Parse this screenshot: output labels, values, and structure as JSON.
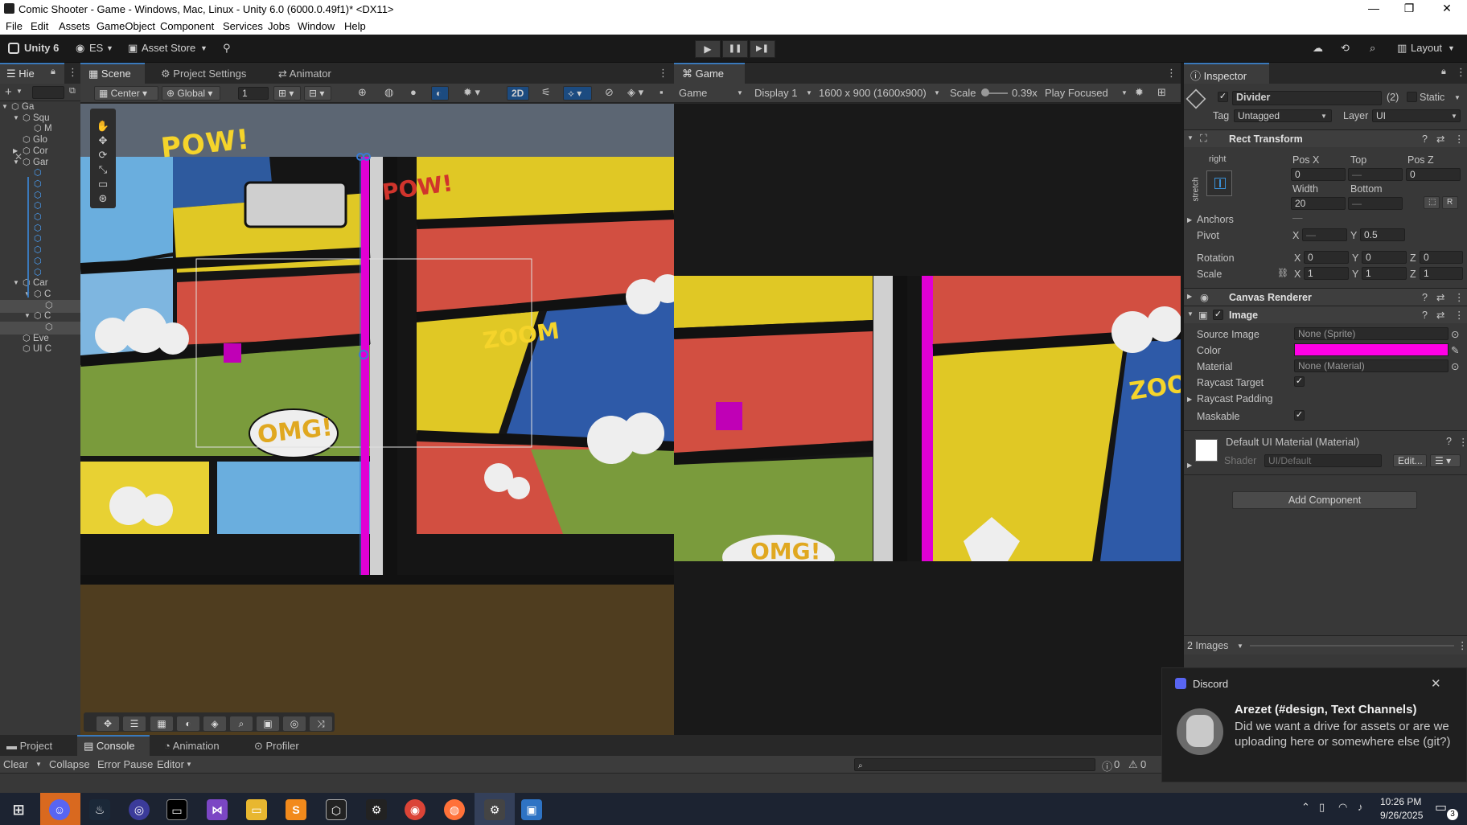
{
  "window": {
    "title": "Comic Shooter - Game - Windows, Mac, Linux - Unity 6.0 (6000.0.49f1)* <DX11>",
    "min": "—",
    "max": "❐",
    "close": "✕"
  },
  "menu": [
    "File",
    "Edit",
    "Assets",
    "GameObject",
    "Component",
    "Services",
    "Jobs",
    "Window",
    "Help"
  ],
  "toolbar": {
    "unity_label": "Unity 6",
    "account": "ES",
    "asset_store": "Asset Store",
    "play": "▶",
    "pause": "❚❚",
    "step": "▶❚",
    "layout": "Layout"
  },
  "hierarchy": {
    "tab": "Hie",
    "rows": [
      "Ga",
      "Squ",
      "M",
      "Glo",
      "Cor",
      "Gar",
      "",
      "",
      "",
      "",
      "",
      "",
      "",
      "",
      "",
      "",
      "Car",
      "C",
      "",
      "C",
      "",
      "Eve",
      "UI C"
    ]
  },
  "scene": {
    "tabs": [
      "Scene",
      "Project Settings",
      "Animator"
    ],
    "pivot": "Center",
    "space": "Global",
    "grid_value": "1",
    "mode_2d": "2D",
    "comic_words": {
      "pow": "POW!",
      "zoom": "ZOOM",
      "omg": "OMG!",
      "pow2": "POW!"
    }
  },
  "game": {
    "tab": "Game",
    "mode": "Game",
    "display": "Display 1",
    "resolution": "1600 x 900 (1600x900)",
    "scale_label": "Scale",
    "scale_value": "0.39x",
    "play_focus": "Play Focused",
    "words": {
      "omg": "OMG!",
      "zoo": "ZOO"
    }
  },
  "inspector": {
    "tab": "Inspector",
    "object_name": "Divider",
    "count": "(2)",
    "static_label": "Static",
    "tag_label": "Tag",
    "tag_value": "Untagged",
    "layer_label": "Layer",
    "layer_value": "UI",
    "rect": {
      "title": "Rect Transform",
      "anchor_h": "right",
      "anchor_v": "stretch",
      "pos_x_label": "Pos X",
      "pos_x": "0",
      "top_label": "Top",
      "top": "—",
      "pos_z_label": "Pos Z",
      "pos_z": "0",
      "width_label": "Width",
      "width": "20",
      "bottom_label": "Bottom",
      "bottom": "—",
      "r_btn": "R",
      "anchors": "Anchors",
      "anchors_val": "—",
      "pivot": "Pivot",
      "pivot_x_label": "X",
      "pivot_x": "—",
      "pivot_y_label": "Y",
      "pivot_y": "0.5",
      "rotation": "Rotation",
      "rx": "0",
      "ry": "0",
      "rz": "0",
      "scale": "Scale",
      "sx": "1",
      "sy": "1",
      "sz": "1",
      "x": "X",
      "y": "Y",
      "z": "Z"
    },
    "canvas_renderer": "Canvas Renderer",
    "image": {
      "title": "Image",
      "source_label": "Source Image",
      "source": "None (Sprite)",
      "color_label": "Color",
      "color": "#ff00e6",
      "material_label": "Material",
      "material": "None (Material)",
      "raycast_target": "Raycast Target",
      "raycast_padding": "Raycast Padding",
      "maskable": "Maskable"
    },
    "material_block": {
      "name": "Default UI Material (Material)",
      "shader_label": "Shader",
      "shader": "UI/Default",
      "edit": "Edit..."
    },
    "add_component": "Add Component",
    "preview": "2 Images"
  },
  "bottom": {
    "tabs": [
      "Project",
      "Console",
      "Animation",
      "Profiler"
    ],
    "clear": "Clear",
    "collapse": "Collapse",
    "error_pause": "Error Pause",
    "editor": "Editor",
    "warn_count": "0",
    "err_count": "0"
  },
  "discord": {
    "app": "Discord",
    "title": "Arezet (#design, Text Channels)",
    "message": "Did we want a drive for assets or are we uploading here or somewhere else (git?)",
    "close": "✕"
  },
  "taskbar": {
    "time": "10:26 PM",
    "date": "9/26/2025",
    "badge": "3"
  }
}
